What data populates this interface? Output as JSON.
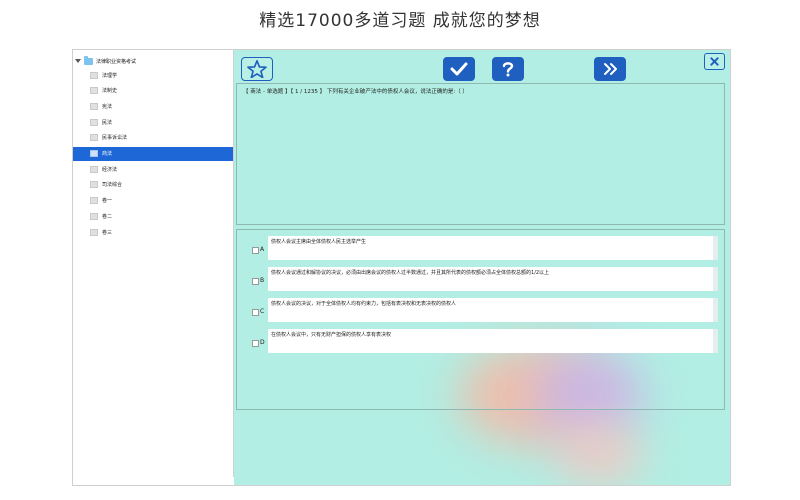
{
  "headline": "精选17000多道习题  成就您的梦想",
  "sidebar": {
    "root_label": "法律职业资格考试",
    "items": [
      {
        "label": "法理学"
      },
      {
        "label": "法制史"
      },
      {
        "label": "宪法"
      },
      {
        "label": "民法"
      },
      {
        "label": "民事诉讼法"
      },
      {
        "label": "商法"
      },
      {
        "label": "经济法"
      },
      {
        "label": "司法综合"
      },
      {
        "label": "卷一"
      },
      {
        "label": "卷二"
      },
      {
        "label": "卷三"
      }
    ],
    "selected_index": 5
  },
  "toolbar": {
    "favorite_icon": "star-icon",
    "check_icon": "checkmark-icon",
    "help_icon": "question-icon",
    "next_icon": "double-chevron-right-icon",
    "close_icon": "close-icon",
    "accent_color": "#1f5fbf"
  },
  "question": {
    "text": "【 商法 - 单选题 】【 1 / 1235 】  下列有关企业破产法中的债权人会议，说法正确的是:（   ）"
  },
  "options": [
    {
      "letter": "A",
      "text": "债权人会议主席由全体债权人民主选举产生"
    },
    {
      "letter": "B",
      "text": "债权人会议通过和解协议的决议，必须由出席会议的债权人过半数通过，并且其所代表的债权额必须占全体债权总额的1/2以上"
    },
    {
      "letter": "C",
      "text": "债权人会议的决议，对于全体债权人均有约束力，包括有表决权和无表决权的债权人"
    },
    {
      "letter": "D",
      "text": "在债权人会议中，只有无财产担保的债权人享有表决权"
    }
  ]
}
